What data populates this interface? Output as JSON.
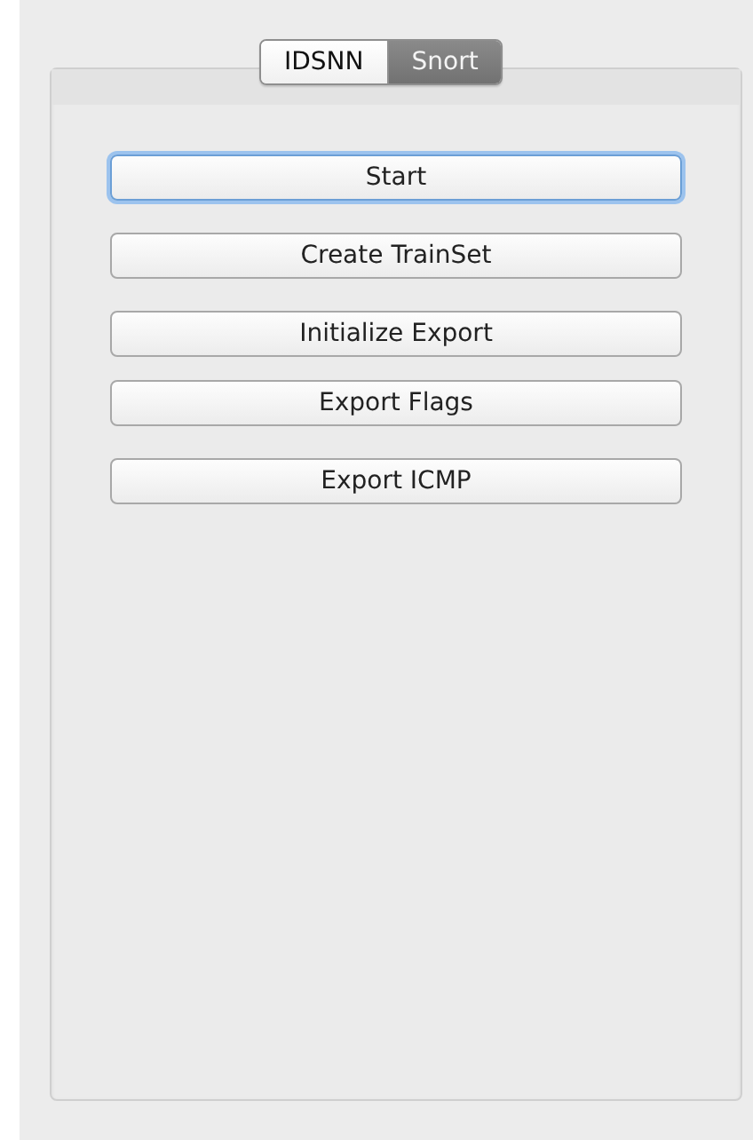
{
  "tabs": [
    {
      "label": "IDSNN",
      "selected": false
    },
    {
      "label": "Snort",
      "selected": true
    }
  ],
  "buttons": [
    {
      "label": "Start",
      "focused": true
    },
    {
      "label": "Create TrainSet",
      "focused": false
    },
    {
      "label": "Initialize Export",
      "focused": false
    },
    {
      "label": "Export Flags",
      "focused": false
    },
    {
      "label": "Export ICMP",
      "focused": false
    }
  ]
}
